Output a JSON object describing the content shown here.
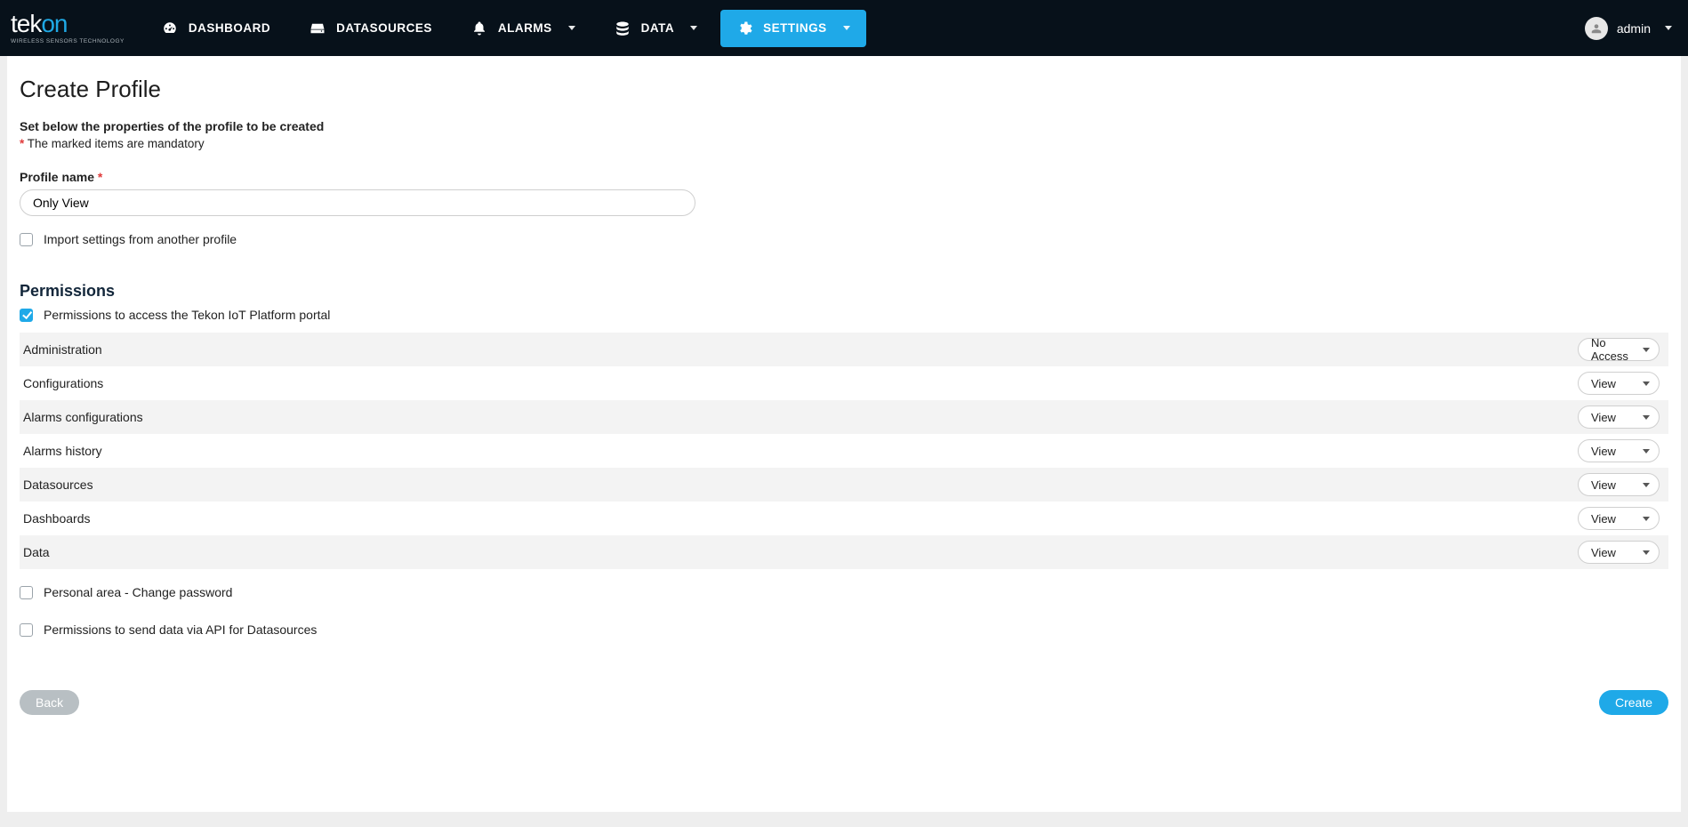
{
  "brand": {
    "name_part1": "tek",
    "name_part2": "on",
    "tagline": "WIRELESS SENSORS TECHNOLOGY"
  },
  "nav": {
    "dashboard": "DASHBOARD",
    "datasources": "DATASOURCES",
    "alarms": "ALARMS",
    "data": "DATA",
    "settings": "SETTINGS"
  },
  "user": {
    "name": "admin"
  },
  "page": {
    "title": "Create Profile",
    "lead": "Set below the properties of the profile to be created",
    "req_note": "The marked items are mandatory",
    "star": "*",
    "profile_name_label": "Profile name",
    "profile_name_value": "Only View",
    "import_label": "Import settings from another profile",
    "permissions_heading": "Permissions",
    "portal_access_label": "Permissions to access the Tekon IoT Platform portal",
    "rows": [
      {
        "label": "Administration",
        "value": "No Access"
      },
      {
        "label": "Configurations",
        "value": "View"
      },
      {
        "label": "Alarms configurations",
        "value": "View"
      },
      {
        "label": "Alarms history",
        "value": "View"
      },
      {
        "label": "Datasources",
        "value": "View"
      },
      {
        "label": "Dashboards",
        "value": "View"
      },
      {
        "label": "Data",
        "value": "View"
      }
    ],
    "change_pw_label": "Personal area - Change password",
    "api_label": "Permissions to send data via API for Datasources",
    "back_label": "Back",
    "create_label": "Create"
  }
}
